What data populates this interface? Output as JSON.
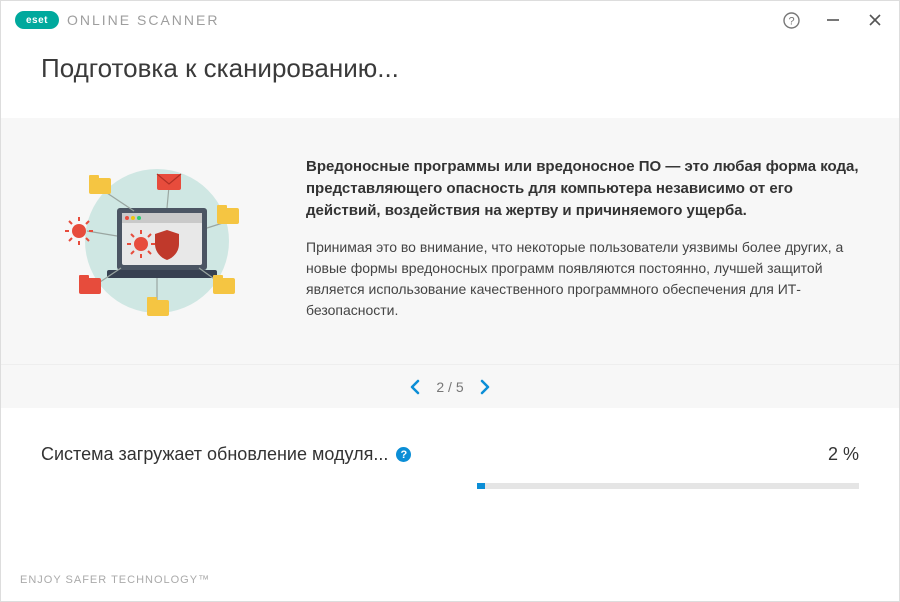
{
  "brand": {
    "logo_text": "eset",
    "product": "ONLINE SCANNER"
  },
  "window": {
    "title": "Подготовка к сканированию..."
  },
  "info": {
    "heading": "Вредоносные программы или вредоносное ПО — это любая форма кода, представляющего опасность для компьютера независимо от его действий, воздействия на жертву и причиняемого ущерба.",
    "body": "Принимая это во внимание, что некоторые пользователи уязвимы более других, а новые формы вредоносных программ появляются постоянно, лучшей защитой является использование качественного программного обеспечения для ИТ-безопасности."
  },
  "pager": {
    "current": 2,
    "total": 5,
    "display": "2 / 5"
  },
  "progress": {
    "label": "Система загружает обновление модуля...",
    "percent_value": 2,
    "percent_display": "2 %"
  },
  "footer": {
    "tagline": "ENJOY SAFER TECHNOLOGY™"
  },
  "colors": {
    "accent": "#0b8ed6",
    "teal": "#00a99d"
  }
}
